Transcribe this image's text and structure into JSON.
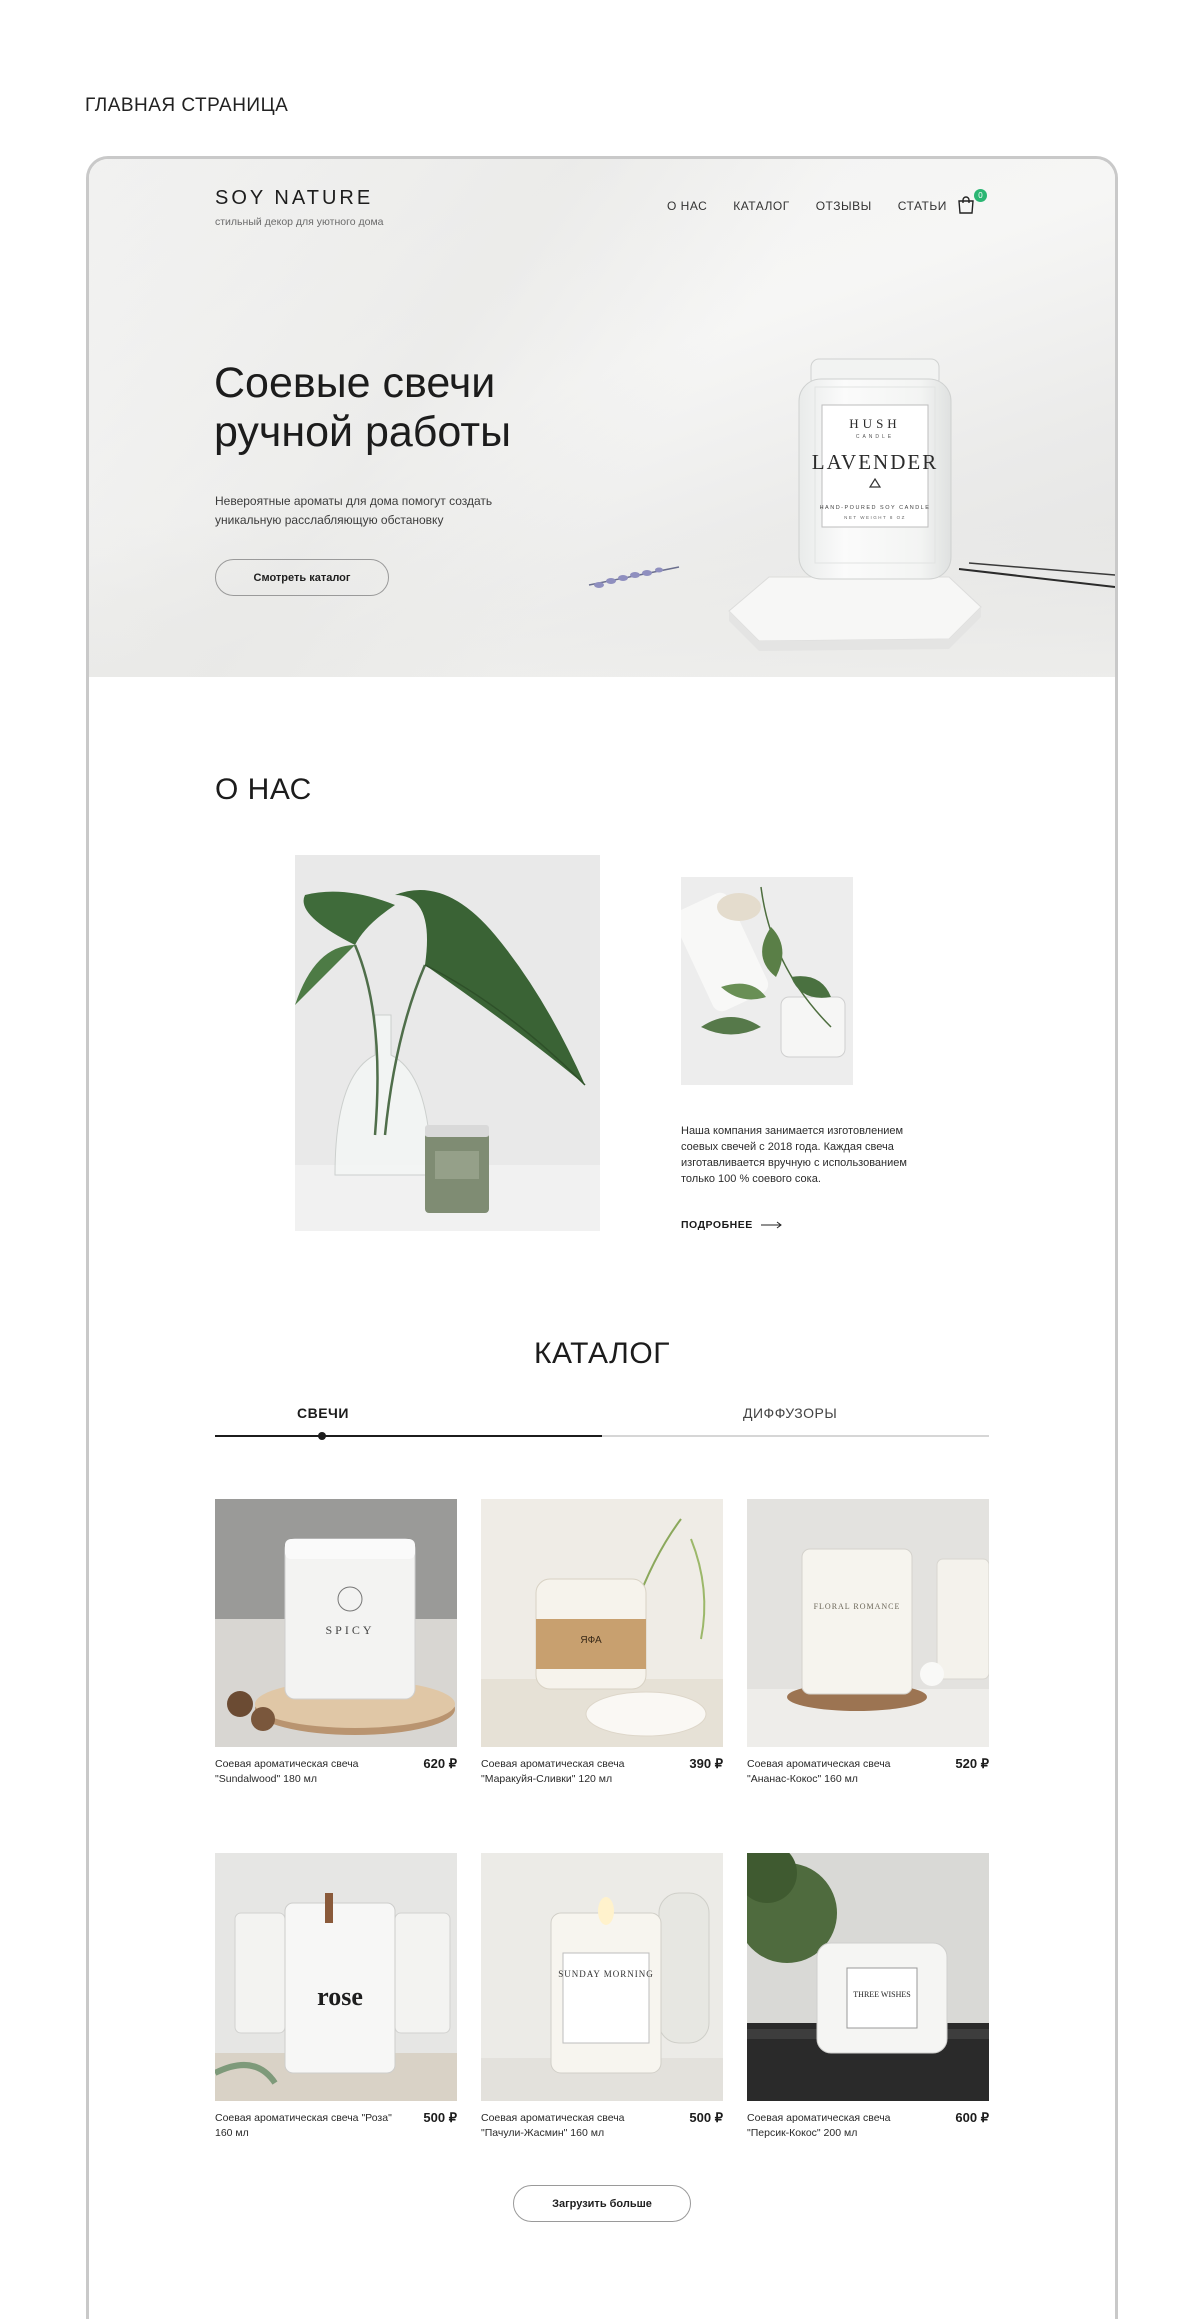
{
  "caption": "ГЛАВНАЯ СТРАНИЦА",
  "header": {
    "logo": "SOY NATURE",
    "tagline": "стильный декор для уютного дома",
    "nav": [
      "О НАС",
      "КАТАЛОГ",
      "ОТЗЫВЫ",
      "СТАТЬИ"
    ],
    "cart_count": "0"
  },
  "hero": {
    "title_line1": "Соевые свечи",
    "title_line2": "ручной работы",
    "subtitle": "Невероятные ароматы для дома помогут создать уникальную расслабляющую обстановку",
    "button": "Смотреть каталог",
    "jar_label": {
      "brand": "HUSH",
      "brand_sub": "CANDLE",
      "name": "LAVENDER",
      "line": "HAND-POURED SOY CANDLE",
      "weight": "NET WEIGHT 8 OZ"
    }
  },
  "about": {
    "title": "О НАС",
    "text": "Наша компания занимается изготовлением соевых свечей с 2018 года. Каждая свеча изготавливается вручную с использованием только 100 % соевого сока.",
    "more": "ПОДРОБНЕЕ"
  },
  "catalog": {
    "title": "КАТАЛОГ",
    "tabs": [
      "СВЕЧИ",
      "ДИФФУЗОРЫ"
    ],
    "active_tab": 0,
    "products": [
      {
        "name": "Соевая ароматическая свеча \"Sundalwood\" 180 мл",
        "price": "620 ₽",
        "label": "SPICY"
      },
      {
        "name": "Соевая ароматическая свеча \"Маракуйя-Сливки\" 120 мл",
        "price": "390 ₽",
        "label": "ЯФА"
      },
      {
        "name": "Соевая ароматическая свеча \"Ананас-Кокос\" 160 мл",
        "price": "520 ₽",
        "label": "FLORAL ROMANCE"
      },
      {
        "name": "Соевая ароматическая свеча \"Роза\" 160 мл",
        "price": "500 ₽",
        "label": "rose"
      },
      {
        "name": "Соевая ароматическая свеча \"Пачули-Жасмин\" 160 мл",
        "price": "500 ₽",
        "label": "SUNDAY MORNING"
      },
      {
        "name": "Соевая ароматическая свеча \"Персик-Кокос\" 200 мл",
        "price": "600 ₽",
        "label": "THREE WISHES"
      }
    ],
    "load_more": "Загрузить больше"
  },
  "colors": {
    "accent_badge": "#2bb673",
    "text": "#1c1c1c",
    "leaf": "#3e6b3a"
  }
}
